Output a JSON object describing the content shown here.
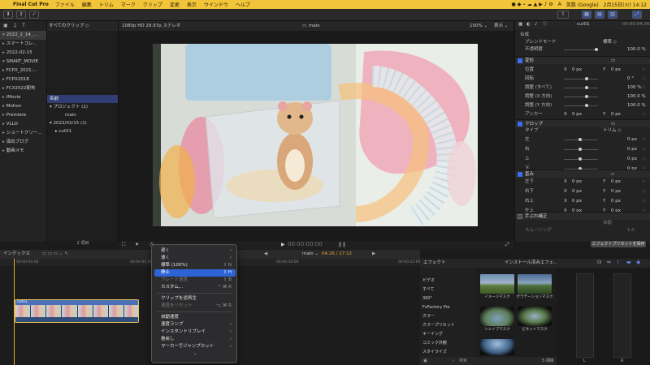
{
  "menubar": {
    "app": "Final Cut Pro",
    "items": [
      "ファイル",
      "編集",
      "トリム",
      "マーク",
      "クリップ",
      "変更",
      "表示",
      "ウインドウ",
      "ヘルプ"
    ],
    "ime": "A",
    "search": "英数 (Google)",
    "datetime": "2月15日(火) 14:12"
  },
  "library": {
    "items": [
      {
        "label": "2022_2_14_...",
        "icon": "▾"
      },
      {
        "label": "スマートコレ...",
        "icon": "▸"
      },
      {
        "label": "2022-02-15",
        "icon": "▸"
      },
      {
        "label": "SMART_MOVIE",
        "icon": "▾"
      },
      {
        "label": "FCPX_2021-...",
        "icon": "▸"
      },
      {
        "label": "FCPX2018",
        "icon": "▸"
      },
      {
        "label": "FCX2022配布",
        "icon": "▸"
      },
      {
        "label": "iMovie",
        "icon": "▸"
      },
      {
        "label": "Motion",
        "icon": "▸"
      },
      {
        "label": "Premiere",
        "icon": "▸"
      },
      {
        "label": "VLLO",
        "icon": "▸"
      },
      {
        "label": "ショートクリー...",
        "icon": "▸"
      },
      {
        "label": "演出ブログ",
        "icon": "▸"
      },
      {
        "label": "動画メモ",
        "icon": "▸"
      }
    ]
  },
  "browser": {
    "filter": "すべてのクリップ ◇",
    "column_name": "名前",
    "rows": [
      "▾ プロジェクト (1)",
      "main",
      "▾ 2022/02/15 (1)",
      "▸ cut01"
    ],
    "count": "2 項目"
  },
  "viewer": {
    "format": "1080p HD 29.97p ステレオ",
    "title": "main",
    "zoom": "100% ⌄",
    "view": "表示 ⌄",
    "timecode": "00:00:00:00"
  },
  "inspector": {
    "clip_name": "cut01",
    "duration": "00:00:04:26",
    "composite": "合成",
    "blend_mode_label": "ブレンドモード",
    "blend_mode_value": "標準 ◇",
    "opacity_label": "不透明度",
    "opacity_value": "100.0 %",
    "transform": {
      "title": "変形",
      "rows": [
        {
          "label": "位置",
          "x": "X",
          "xv": "0 px",
          "y": "Y",
          "yv": "0 px"
        },
        {
          "label": "回転",
          "x": "",
          "xv": "0 °",
          "y": "",
          "yv": ""
        },
        {
          "label": "調整 (すべて)",
          "x": "",
          "xv": "100 %",
          "y": "",
          "yv": ""
        },
        {
          "label": "調整 (X 方向)",
          "x": "",
          "xv": "100.0 %",
          "y": "",
          "yv": ""
        },
        {
          "label": "調整 (Y 方向)",
          "x": "",
          "xv": "100.0 %",
          "y": "",
          "yv": ""
        },
        {
          "label": "アンカー",
          "x": "X",
          "xv": "0 px",
          "y": "Y",
          "yv": "0 px"
        }
      ]
    },
    "crop": {
      "title": "クロップ",
      "type_label": "タイプ",
      "type_value": "トリム ◇",
      "rows": [
        {
          "label": "左",
          "xv": "0 px"
        },
        {
          "label": "右",
          "xv": "0 px"
        },
        {
          "label": "上",
          "xv": "0 px"
        },
        {
          "label": "下",
          "xv": "0 px"
        }
      ]
    },
    "distort": {
      "title": "歪み",
      "rows": [
        {
          "label": "左下",
          "x": "X",
          "xv": "0 px",
          "y": "Y",
          "yv": "0 px"
        },
        {
          "label": "右下",
          "x": "X",
          "xv": "0 px",
          "y": "Y",
          "yv": "0 px"
        },
        {
          "label": "右上",
          "x": "X",
          "xv": "0 px",
          "y": "Y",
          "yv": "0 px"
        },
        {
          "label": "左上",
          "x": "X",
          "xv": "0 px",
          "y": "Y",
          "yv": "0 px"
        }
      ]
    },
    "stabilize": {
      "title": "手ぶれ補正",
      "method_value": "自動",
      "smoothing_label": "スムージング",
      "smoothing_value": "1.0"
    },
    "save_preset": "エフェクトプリセットを保存"
  },
  "timeline": {
    "index": "インデックス",
    "project": "main ⌄",
    "position": "04:26 / 27:12",
    "ruler": [
      "00:00:00:00",
      "00:00:05:00",
      "00:00:10:00",
      "00:00:15:00"
    ],
    "clip_label": "cut01"
  },
  "effects": {
    "title": "エフェクト",
    "installed": "インストール済みエフェ... ⌄",
    "categories": [
      "ビデオ",
      "すべて",
      "360°",
      "FxFactory Pro",
      "カラー",
      "カラープリセット",
      "キーイング",
      "コミック外観",
      "スタイライズ"
    ],
    "thumbnails": [
      "イメージマスク",
      "グラデーションマスク",
      "シェイプマスク",
      "ビネットマスク"
    ],
    "search_placeholder": "検索",
    "count": "5 項目"
  },
  "meters": {
    "labels": [
      "L",
      "R"
    ]
  },
  "context_menu": {
    "items": [
      {
        "label": "遅く",
        "arrow": true
      },
      {
        "label": "速く",
        "arrow": true
      },
      {
        "label": "標準 (100%)",
        "shortcut": "⇧ N",
        "disabled": false
      },
      {
        "label": "静止",
        "shortcut": "⇧ H",
        "highlighted": true
      },
      {
        "label": "ブレード速度",
        "shortcut": "⇧ B",
        "disabled": true
      },
      {
        "label": "カスタム...",
        "shortcut": "^ ⌘ R"
      },
      {
        "sep": true
      },
      {
        "label": "クリップを逆再生"
      },
      {
        "label": "速度をリセット",
        "shortcut": "⌥ ⌘ R",
        "disabled": true
      },
      {
        "sep": true
      },
      {
        "label": "自動速度"
      },
      {
        "label": "速度ランプ",
        "arrow": true
      },
      {
        "label": "インスタントリプレイ",
        "arrow": true
      },
      {
        "label": "巻戻し",
        "arrow": true
      },
      {
        "label": "マーカーでジャンプカット",
        "arrow": true
      }
    ],
    "more": "⌄"
  },
  "colors": {
    "menubar": "#f2c43a",
    "accent": "#2e63d6",
    "clip": "#4a71b8",
    "playhead": "#e8b030"
  }
}
